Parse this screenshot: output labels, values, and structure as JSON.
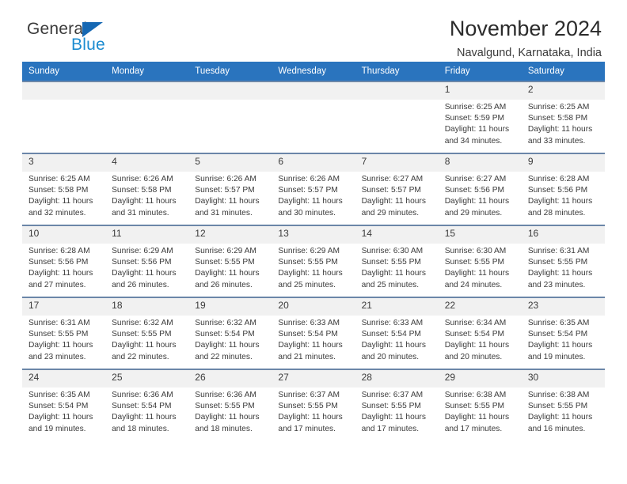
{
  "brand": {
    "name_part1": "General",
    "name_part2": "Blue",
    "accent_blue": "#1668b3",
    "light_blue": "#1b8bd0"
  },
  "header": {
    "title": "November 2024",
    "subtitle": "Navalgund, Karnataka, India"
  },
  "calendar": {
    "header_bg": "#2a74be",
    "weekdays": [
      "Sunday",
      "Monday",
      "Tuesday",
      "Wednesday",
      "Thursday",
      "Friday",
      "Saturday"
    ],
    "labels": {
      "sunrise": "Sunrise:",
      "sunset": "Sunset:",
      "daylight": "Daylight:"
    },
    "weeks": [
      [
        {
          "day": "",
          "empty": true
        },
        {
          "day": "",
          "empty": true
        },
        {
          "day": "",
          "empty": true
        },
        {
          "day": "",
          "empty": true
        },
        {
          "day": "",
          "empty": true
        },
        {
          "day": "1",
          "sunrise": "Sunrise: 6:25 AM",
          "sunset": "Sunset: 5:59 PM",
          "daylight": "Daylight: 11 hours and 34 minutes."
        },
        {
          "day": "2",
          "sunrise": "Sunrise: 6:25 AM",
          "sunset": "Sunset: 5:58 PM",
          "daylight": "Daylight: 11 hours and 33 minutes."
        }
      ],
      [
        {
          "day": "3",
          "sunrise": "Sunrise: 6:25 AM",
          "sunset": "Sunset: 5:58 PM",
          "daylight": "Daylight: 11 hours and 32 minutes."
        },
        {
          "day": "4",
          "sunrise": "Sunrise: 6:26 AM",
          "sunset": "Sunset: 5:58 PM",
          "daylight": "Daylight: 11 hours and 31 minutes."
        },
        {
          "day": "5",
          "sunrise": "Sunrise: 6:26 AM",
          "sunset": "Sunset: 5:57 PM",
          "daylight": "Daylight: 11 hours and 31 minutes."
        },
        {
          "day": "6",
          "sunrise": "Sunrise: 6:26 AM",
          "sunset": "Sunset: 5:57 PM",
          "daylight": "Daylight: 11 hours and 30 minutes."
        },
        {
          "day": "7",
          "sunrise": "Sunrise: 6:27 AM",
          "sunset": "Sunset: 5:57 PM",
          "daylight": "Daylight: 11 hours and 29 minutes."
        },
        {
          "day": "8",
          "sunrise": "Sunrise: 6:27 AM",
          "sunset": "Sunset: 5:56 PM",
          "daylight": "Daylight: 11 hours and 29 minutes."
        },
        {
          "day": "9",
          "sunrise": "Sunrise: 6:28 AM",
          "sunset": "Sunset: 5:56 PM",
          "daylight": "Daylight: 11 hours and 28 minutes."
        }
      ],
      [
        {
          "day": "10",
          "sunrise": "Sunrise: 6:28 AM",
          "sunset": "Sunset: 5:56 PM",
          "daylight": "Daylight: 11 hours and 27 minutes."
        },
        {
          "day": "11",
          "sunrise": "Sunrise: 6:29 AM",
          "sunset": "Sunset: 5:56 PM",
          "daylight": "Daylight: 11 hours and 26 minutes."
        },
        {
          "day": "12",
          "sunrise": "Sunrise: 6:29 AM",
          "sunset": "Sunset: 5:55 PM",
          "daylight": "Daylight: 11 hours and 26 minutes."
        },
        {
          "day": "13",
          "sunrise": "Sunrise: 6:29 AM",
          "sunset": "Sunset: 5:55 PM",
          "daylight": "Daylight: 11 hours and 25 minutes."
        },
        {
          "day": "14",
          "sunrise": "Sunrise: 6:30 AM",
          "sunset": "Sunset: 5:55 PM",
          "daylight": "Daylight: 11 hours and 25 minutes."
        },
        {
          "day": "15",
          "sunrise": "Sunrise: 6:30 AM",
          "sunset": "Sunset: 5:55 PM",
          "daylight": "Daylight: 11 hours and 24 minutes."
        },
        {
          "day": "16",
          "sunrise": "Sunrise: 6:31 AM",
          "sunset": "Sunset: 5:55 PM",
          "daylight": "Daylight: 11 hours and 23 minutes."
        }
      ],
      [
        {
          "day": "17",
          "sunrise": "Sunrise: 6:31 AM",
          "sunset": "Sunset: 5:55 PM",
          "daylight": "Daylight: 11 hours and 23 minutes."
        },
        {
          "day": "18",
          "sunrise": "Sunrise: 6:32 AM",
          "sunset": "Sunset: 5:55 PM",
          "daylight": "Daylight: 11 hours and 22 minutes."
        },
        {
          "day": "19",
          "sunrise": "Sunrise: 6:32 AM",
          "sunset": "Sunset: 5:54 PM",
          "daylight": "Daylight: 11 hours and 22 minutes."
        },
        {
          "day": "20",
          "sunrise": "Sunrise: 6:33 AM",
          "sunset": "Sunset: 5:54 PM",
          "daylight": "Daylight: 11 hours and 21 minutes."
        },
        {
          "day": "21",
          "sunrise": "Sunrise: 6:33 AM",
          "sunset": "Sunset: 5:54 PM",
          "daylight": "Daylight: 11 hours and 20 minutes."
        },
        {
          "day": "22",
          "sunrise": "Sunrise: 6:34 AM",
          "sunset": "Sunset: 5:54 PM",
          "daylight": "Daylight: 11 hours and 20 minutes."
        },
        {
          "day": "23",
          "sunrise": "Sunrise: 6:35 AM",
          "sunset": "Sunset: 5:54 PM",
          "daylight": "Daylight: 11 hours and 19 minutes."
        }
      ],
      [
        {
          "day": "24",
          "sunrise": "Sunrise: 6:35 AM",
          "sunset": "Sunset: 5:54 PM",
          "daylight": "Daylight: 11 hours and 19 minutes."
        },
        {
          "day": "25",
          "sunrise": "Sunrise: 6:36 AM",
          "sunset": "Sunset: 5:54 PM",
          "daylight": "Daylight: 11 hours and 18 minutes."
        },
        {
          "day": "26",
          "sunrise": "Sunrise: 6:36 AM",
          "sunset": "Sunset: 5:55 PM",
          "daylight": "Daylight: 11 hours and 18 minutes."
        },
        {
          "day": "27",
          "sunrise": "Sunrise: 6:37 AM",
          "sunset": "Sunset: 5:55 PM",
          "daylight": "Daylight: 11 hours and 17 minutes."
        },
        {
          "day": "28",
          "sunrise": "Sunrise: 6:37 AM",
          "sunset": "Sunset: 5:55 PM",
          "daylight": "Daylight: 11 hours and 17 minutes."
        },
        {
          "day": "29",
          "sunrise": "Sunrise: 6:38 AM",
          "sunset": "Sunset: 5:55 PM",
          "daylight": "Daylight: 11 hours and 17 minutes."
        },
        {
          "day": "30",
          "sunrise": "Sunrise: 6:38 AM",
          "sunset": "Sunset: 5:55 PM",
          "daylight": "Daylight: 11 hours and 16 minutes."
        }
      ]
    ]
  }
}
